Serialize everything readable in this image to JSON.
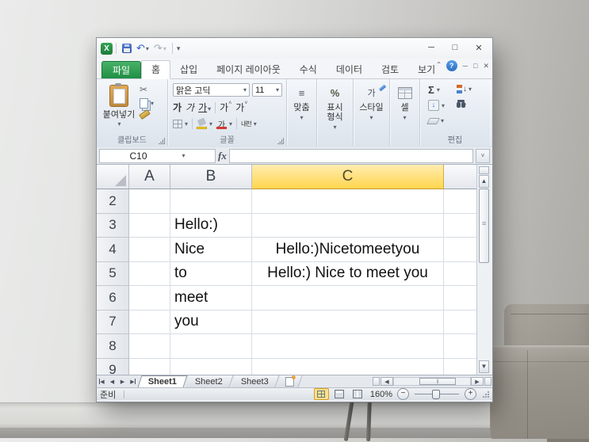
{
  "file_tab": "파일",
  "tabs": [
    "홈",
    "삽입",
    "페이지 레이아웃",
    "수식",
    "데이터",
    "검토",
    "보기"
  ],
  "window_controls": {
    "minimize": "─",
    "maximize": "□",
    "close": "✕",
    "collapse_ribbon": "ˆ",
    "help": "?",
    "wb_minimize": "─",
    "wb_restore": "□",
    "wb_close": "✕"
  },
  "quick_access": {
    "undo": "↶",
    "redo": "↷",
    "logo": "X"
  },
  "ribbon": {
    "paste_label": "붙여넣기",
    "clipboard_group": "클립보드",
    "font_name": "맑은 고딕",
    "font_size": "11",
    "bold": "가",
    "italic": "가",
    "underline": "가",
    "grow_font": "가",
    "shrink_font": "가",
    "font_color": "가",
    "phonetic": "내천",
    "font_group": "글꼴",
    "align_group": "맞춤",
    "number_group_line1": "표시",
    "number_group_line2": "형식",
    "percent": "%",
    "styles_icon": "가",
    "styles_group": "스타일",
    "cells_group": "셀",
    "autosum": "Σ",
    "fill_down": "↓",
    "sort_arrow": "↓",
    "editing_group": "편집"
  },
  "formula_bar": {
    "name_box": "C10",
    "fx": "fx"
  },
  "grid": {
    "col_headers": [
      "A",
      "B",
      "C"
    ],
    "selected_col": "C",
    "row_numbers": [
      "2",
      "3",
      "4",
      "5",
      "6",
      "7",
      "8",
      "9"
    ],
    "rows": [
      {
        "b": "",
        "c": ""
      },
      {
        "b": "Hello:)",
        "c": ""
      },
      {
        "b": "Nice",
        "c": "Hello:)Nicetomeetyou"
      },
      {
        "b": "to",
        "c": "Hello:) Nice to meet you"
      },
      {
        "b": "meet",
        "c": ""
      },
      {
        "b": "you",
        "c": ""
      },
      {
        "b": "",
        "c": ""
      },
      {
        "b": "",
        "c": ""
      }
    ]
  },
  "sheet_tabs": [
    "Sheet1",
    "Sheet2",
    "Sheet3"
  ],
  "status_bar": {
    "ready": "준비",
    "zoom": "160%"
  }
}
